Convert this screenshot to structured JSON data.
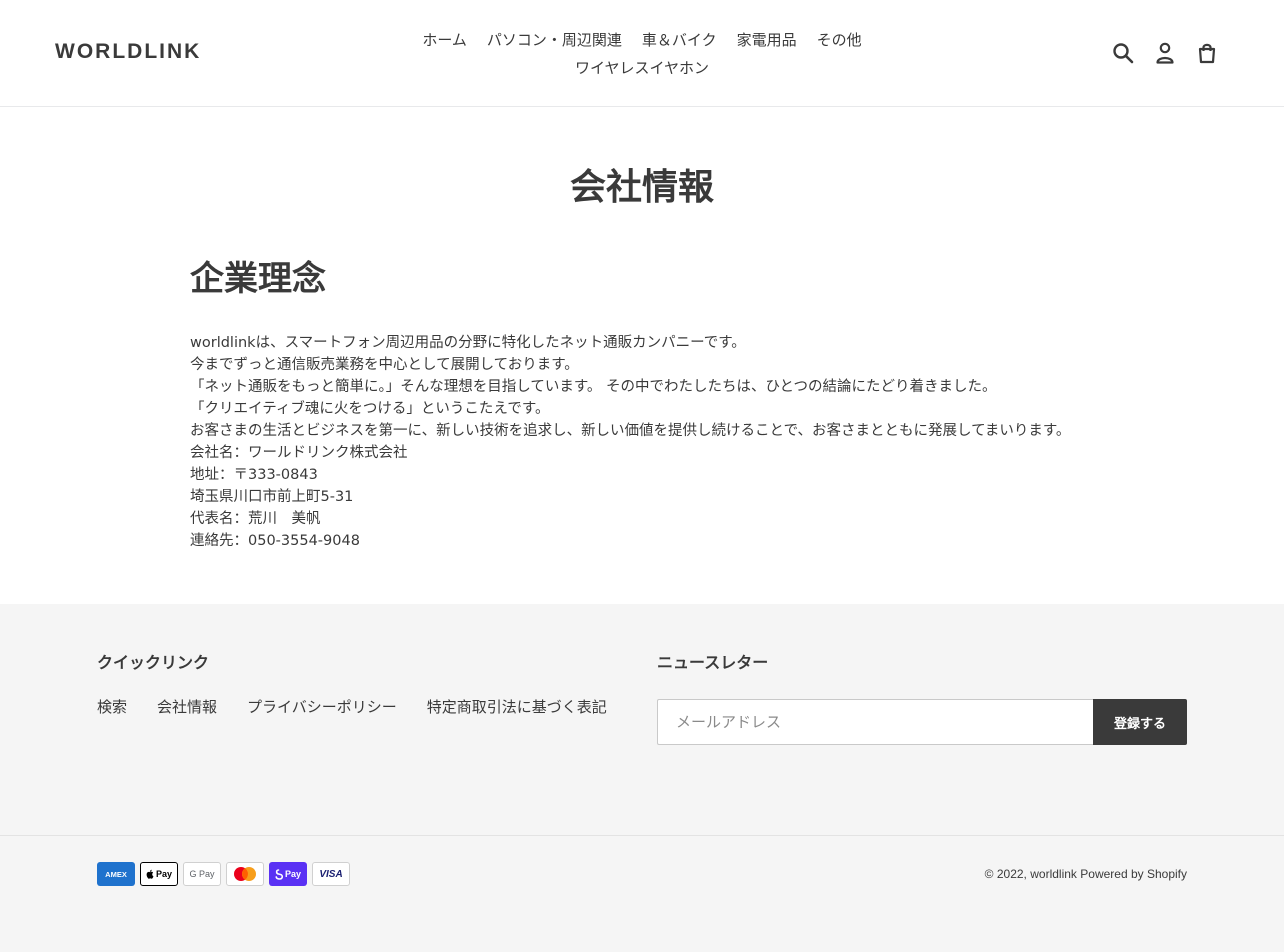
{
  "header": {
    "logo": "WORLDLINK",
    "nav": [
      "ホーム",
      "パソコン・周辺関連",
      "車＆バイク",
      "家電用品",
      "その他",
      "ワイヤレスイヤホン"
    ],
    "icons": [
      "search-icon",
      "account-icon",
      "cart-icon"
    ]
  },
  "main": {
    "page_title": "会社情報",
    "heading": "企業理念",
    "lines": [
      "worldlinkは、スマートフォン周辺用品の分野に特化したネット通販カンパニーです。",
      "今までずっと通信販売業務を中心として展開しております。",
      "「ネット通販をもっと簡単に。」そんな理想を目指しています。 その中でわたしたちは、ひとつの結論にたどり着きました。",
      "「クリエイティブ魂に火をつける」というこたえです。",
      "お客さまの生活とビジネスを第一に、新しい技術を追求し、新しい価値を提供し続けることで、お客さまとともに発展してまいります。",
      "会社名：ワールドリンク株式会社",
      "地址：〒333-0843",
      "埼玉県川口市前上町5-31",
      "代表名：荒川　美帆",
      "連絡先：050-3554-9048"
    ]
  },
  "footer": {
    "quick_links_title": "クイックリンク",
    "quick_links": [
      "検索",
      "会社情報",
      "プライバシーポリシー",
      "特定商取引法に基づく表記"
    ],
    "newsletter_title": "ニュースレター",
    "email_placeholder": "メールアドレス",
    "subscribe_label": "登録する",
    "payments": [
      "AMEX",
      "Pay",
      "G Pay",
      "",
      "Pay",
      "VISA"
    ],
    "copyright": "© 2022,",
    "shop_name": "worldlink",
    "powered_by": "Powered by Shopify",
    "colors": {
      "background": "#f5f5f5",
      "button": "#3a3a3a",
      "amex": "#1f72cd",
      "shop_pay": "#5a31f4"
    }
  }
}
